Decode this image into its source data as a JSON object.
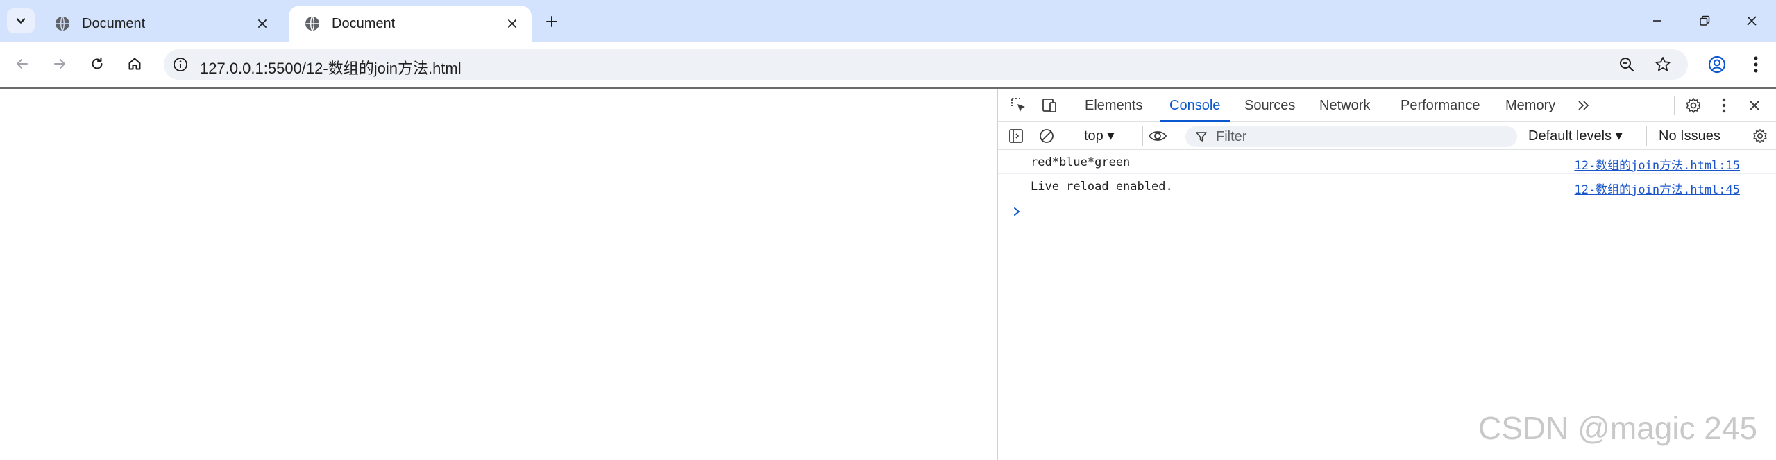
{
  "browser": {
    "tabs": [
      {
        "title": "Document",
        "active": false
      },
      {
        "title": "Document",
        "active": true
      }
    ],
    "address_bar": {
      "url": "127.0.0.1:5500/12-数组的join方法.html"
    }
  },
  "devtools": {
    "panels": [
      "Elements",
      "Console",
      "Sources",
      "Network",
      "Performance",
      "Memory"
    ],
    "active_panel": "Console",
    "console_toolbar": {
      "context": "top ▾",
      "filter_placeholder": "Filter",
      "levels": "Default levels ▾",
      "issues": "No Issues"
    },
    "messages": [
      {
        "text": "red*blue*green",
        "source": "12-数组的join方法.html:15"
      },
      {
        "text": "Live reload enabled.",
        "source": "12-数组的join方法.html:45"
      }
    ],
    "accent_color": "#0b57d0"
  },
  "watermark": "CSDN @magic 245",
  "icons": {
    "tab_search": "chevron-down-icon",
    "favicon": "globe-icon",
    "tab_close": "close-icon",
    "new_tab": "plus-icon",
    "back": "arrow-left-icon",
    "forward": "arrow-right-icon",
    "reload": "reload-icon",
    "home": "home-icon",
    "site_info": "info-icon",
    "zoom": "zoom-icon",
    "bookmark": "star-icon",
    "profile": "profile-icon",
    "menu": "kebab-icon"
  }
}
